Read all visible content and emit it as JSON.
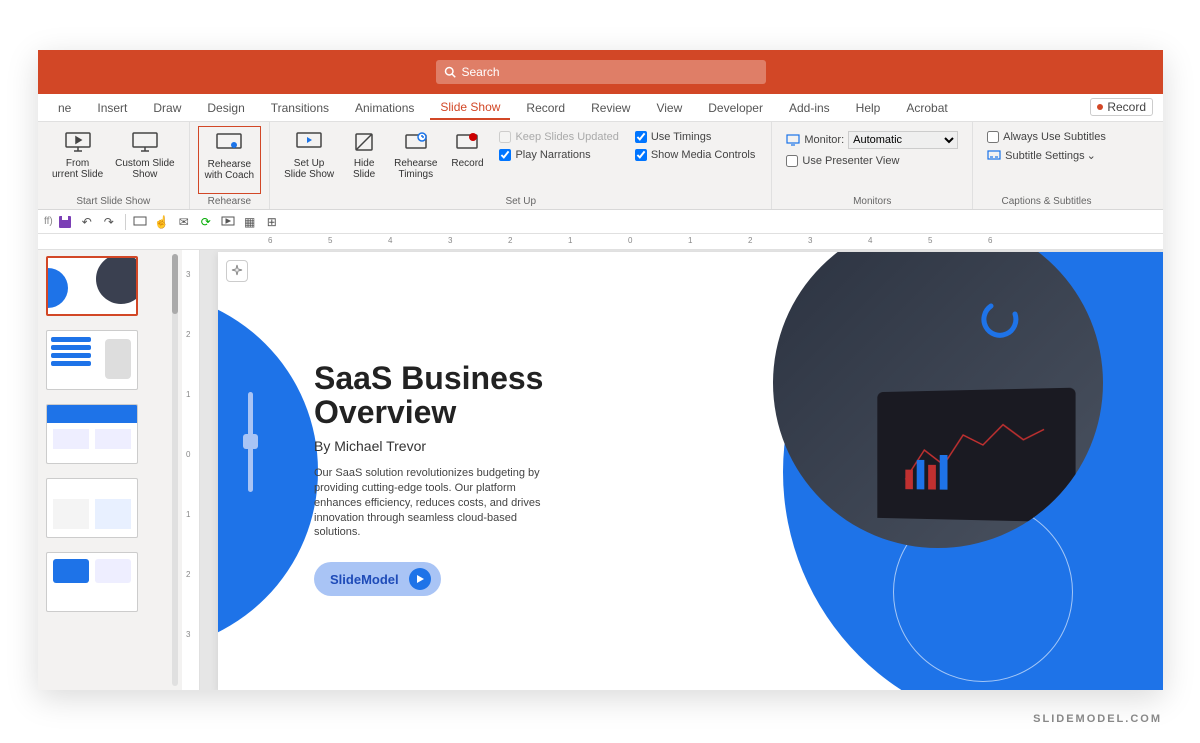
{
  "search": {
    "placeholder": "Search"
  },
  "tabs": {
    "items": [
      "ne",
      "Insert",
      "Draw",
      "Design",
      "Transitions",
      "Animations",
      "Slide Show",
      "Record",
      "Review",
      "View",
      "Developer",
      "Add-ins",
      "Help",
      "Acrobat"
    ],
    "active_index": 6,
    "record_button": "Record"
  },
  "ribbon": {
    "group_start": {
      "label": "Start Slide Show",
      "from_current": "From\nurrent Slide",
      "custom": "Custom Slide\nShow"
    },
    "group_rehearse": {
      "label": "Rehearse",
      "coach": "Rehearse\nwith Coach"
    },
    "group_setup": {
      "label": "Set Up",
      "setup": "Set Up\nSlide Show",
      "hide": "Hide\nSlide",
      "timings": "Rehearse\nTimings",
      "record": "Record",
      "keep_updated": "Keep Slides Updated",
      "play_narrations": "Play Narrations",
      "use_timings": "Use Timings",
      "show_media": "Show Media Controls"
    },
    "group_monitors": {
      "label": "Monitors",
      "monitor_label": "Monitor:",
      "monitor_value": "Automatic",
      "presenter_view": "Use Presenter View"
    },
    "group_captions": {
      "label": "Captions & Subtitles",
      "always_use": "Always Use Subtitles",
      "settings": "Subtitle Settings"
    }
  },
  "qat": {
    "off_label": "ff)"
  },
  "slide": {
    "title_line1": "SaaS Business",
    "title_line2": "Overview",
    "author": "By Michael Trevor",
    "body": "Our SaaS solution revolutionizes budgeting by providing cutting-edge tools. Our platform enhances efficiency, reduces costs, and drives innovation through seamless cloud-based solutions.",
    "pill": "SlideModel"
  },
  "brand": "SLIDEMODEL.COM",
  "ruler_marks": [
    "6",
    "5",
    "4",
    "3",
    "2",
    "1",
    "0",
    "1",
    "2",
    "3",
    "4",
    "5",
    "6"
  ],
  "vruler_marks": [
    "3",
    "2",
    "1",
    "0",
    "1",
    "2",
    "3"
  ]
}
